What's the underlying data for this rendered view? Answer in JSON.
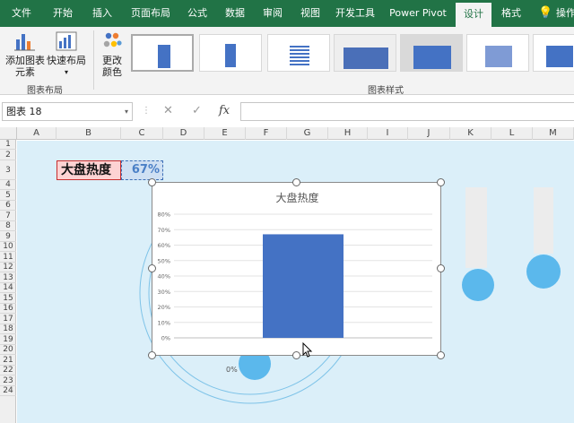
{
  "ribbon_tabs": [
    "文件",
    "开始",
    "插入",
    "页面布局",
    "公式",
    "数据",
    "审阅",
    "视图",
    "开发工具",
    "Power Pivot",
    "设计",
    "格式"
  ],
  "active_tab": "设计",
  "tell_me_label": "操作",
  "ribbon": {
    "add_element_label": "添加图表\n元素",
    "quick_layout_label": "快速布局",
    "change_colors_label": "更改\n颜色",
    "group_layout_label": "图表布局",
    "group_styles_label": "图表样式"
  },
  "formula_bar": {
    "name_box": "图表 18",
    "cancel_icon": "✕",
    "enter_icon": "✓",
    "fx_label": "fx",
    "formula": ""
  },
  "columns": [
    "A",
    "B",
    "C",
    "D",
    "E",
    "F",
    "G",
    "H",
    "I",
    "J",
    "K",
    "L",
    "M"
  ],
  "rows": [
    "1",
    "2",
    "3",
    "4",
    "5",
    "6",
    "7",
    "8",
    "9",
    "10",
    "11",
    "12",
    "13",
    "14",
    "15",
    "16",
    "17",
    "18",
    "19",
    "20",
    "21",
    "22",
    "23",
    "24"
  ],
  "cells": {
    "B3": "大盘热度",
    "C3": "67%"
  },
  "background_labels": {
    "zero_pct_left": "0%"
  },
  "colors": {
    "ribbon_green": "#217346",
    "bar_blue": "#4472c4",
    "thermo_blue": "#5bb8ec",
    "sheet_bg": "#dbeff9"
  },
  "chart_data": {
    "type": "bar",
    "title": "大盘热度",
    "categories": [
      ""
    ],
    "values": [
      67
    ],
    "unit": "%",
    "yticks": [
      "0%",
      "10%",
      "20%",
      "30%",
      "40%",
      "50%",
      "60%",
      "70%",
      "80%"
    ],
    "ylim": [
      0,
      80
    ],
    "grid": true
  }
}
